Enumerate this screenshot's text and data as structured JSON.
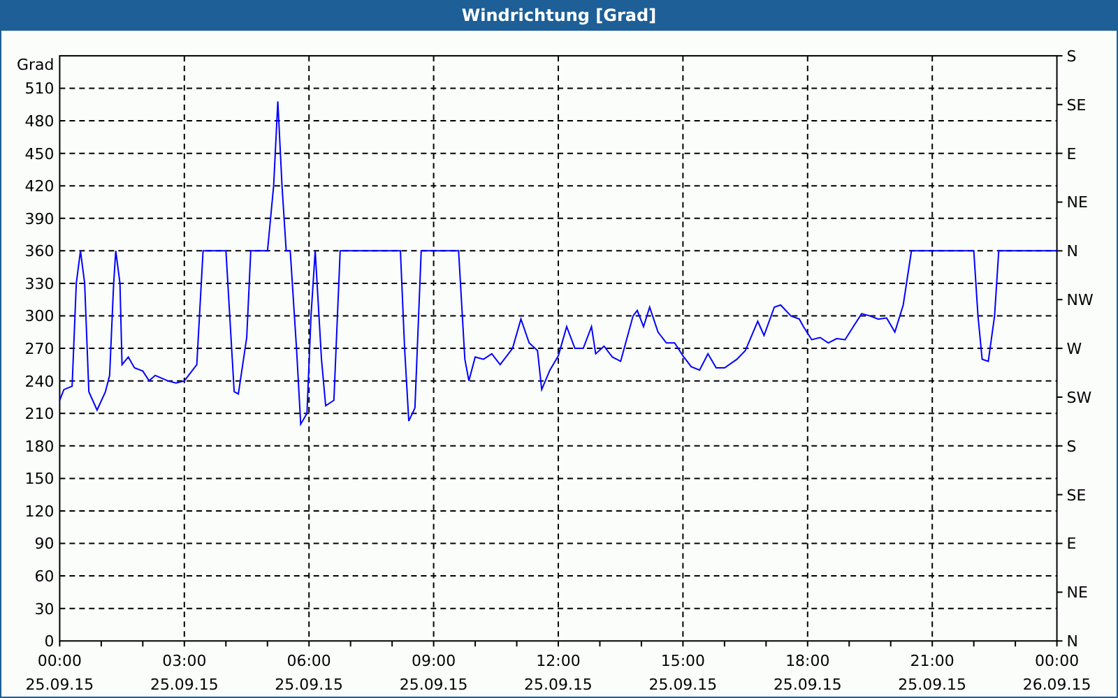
{
  "window": {
    "title": "Windrichtung [Grad]"
  },
  "chart": {
    "right_axis_labels": [
      "S",
      "SE",
      "E",
      "NE",
      "N",
      "NW",
      "W",
      "SW",
      "S",
      "SE",
      "E",
      "NE",
      "N"
    ],
    "xtick_dates": [
      "25.09.15",
      "25.09.15",
      "25.09.15",
      "25.09.15",
      "25.09.15",
      "25.09.15",
      "25.09.15",
      "25.09.15",
      "26.09.15"
    ],
    "chart_data": {
      "type": "line",
      "grid": true,
      "ylabel": "Grad",
      "xlim": [
        0,
        24
      ],
      "ylim": [
        0,
        540
      ],
      "yticks": [
        0,
        30,
        60,
        90,
        120,
        150,
        180,
        210,
        240,
        270,
        300,
        330,
        360,
        390,
        420,
        450,
        480,
        510
      ],
      "xticks": [
        {
          "value": 0,
          "label": "00:00"
        },
        {
          "value": 3,
          "label": "03:00"
        },
        {
          "value": 6,
          "label": "06:00"
        },
        {
          "value": 9,
          "label": "09:00"
        },
        {
          "value": 12,
          "label": "12:00"
        },
        {
          "value": 15,
          "label": "15:00"
        },
        {
          "value": 18,
          "label": "18:00"
        },
        {
          "value": 21,
          "label": "21:00"
        },
        {
          "value": 24,
          "label": "00:00"
        }
      ],
      "x": [
        0,
        0.1,
        0.3,
        0.4,
        0.5,
        0.6,
        0.7,
        0.9,
        1.1,
        1.2,
        1.3,
        1.35,
        1.45,
        1.5,
        1.65,
        1.8,
        2.0,
        2.15,
        2.3,
        2.6,
        2.8,
        3.0,
        3.3,
        3.45,
        4.0,
        4.2,
        4.3,
        4.5,
        4.6,
        5.0,
        5.15,
        5.25,
        5.35,
        5.45,
        5.55,
        5.7,
        5.8,
        5.95,
        6.05,
        6.15,
        6.3,
        6.4,
        6.6,
        6.75,
        8.2,
        8.3,
        8.4,
        8.55,
        8.7,
        9.6,
        9.75,
        9.85,
        10.0,
        10.2,
        10.4,
        10.6,
        10.9,
        11.1,
        11.3,
        11.5,
        11.6,
        11.8,
        12.0,
        12.2,
        12.4,
        12.6,
        12.8,
        12.9,
        13.1,
        13.3,
        13.5,
        13.8,
        13.9,
        14.05,
        14.2,
        14.4,
        14.6,
        14.8,
        15.0,
        15.2,
        15.4,
        15.6,
        15.8,
        16.0,
        16.3,
        16.5,
        16.8,
        16.95,
        17.2,
        17.35,
        17.6,
        17.8,
        17.9,
        18.1,
        18.3,
        18.5,
        18.7,
        18.9,
        19.1,
        19.3,
        19.5,
        19.7,
        19.9,
        20.1,
        20.3,
        20.5,
        22.0,
        22.1,
        22.2,
        22.35,
        22.5,
        22.6,
        24
      ],
      "series": [
        {
          "color": "#0000ff",
          "values": [
            222,
            232,
            235,
            330,
            360,
            330,
            230,
            213,
            230,
            245,
            330,
            360,
            330,
            255,
            262,
            252,
            249,
            240,
            245,
            240,
            238,
            240,
            255,
            360,
            360,
            230,
            228,
            280,
            360,
            360,
            420,
            498,
            420,
            360,
            360,
            270,
            200,
            210,
            300,
            360,
            260,
            217,
            222,
            360,
            360,
            270,
            203,
            215,
            360,
            360,
            260,
            240,
            262,
            260,
            265,
            255,
            270,
            297,
            275,
            268,
            232,
            250,
            263,
            290,
            270,
            270,
            290,
            265,
            272,
            262,
            258,
            300,
            305,
            290,
            308,
            285,
            275,
            275,
            263,
            253,
            250,
            265,
            252,
            252,
            260,
            268,
            295,
            282,
            308,
            310,
            300,
            297,
            290,
            278,
            280,
            275,
            279,
            278,
            290,
            302,
            300,
            297,
            298,
            285,
            310,
            360,
            360,
            300,
            260,
            258,
            300,
            360,
            360
          ]
        }
      ]
    }
  }
}
